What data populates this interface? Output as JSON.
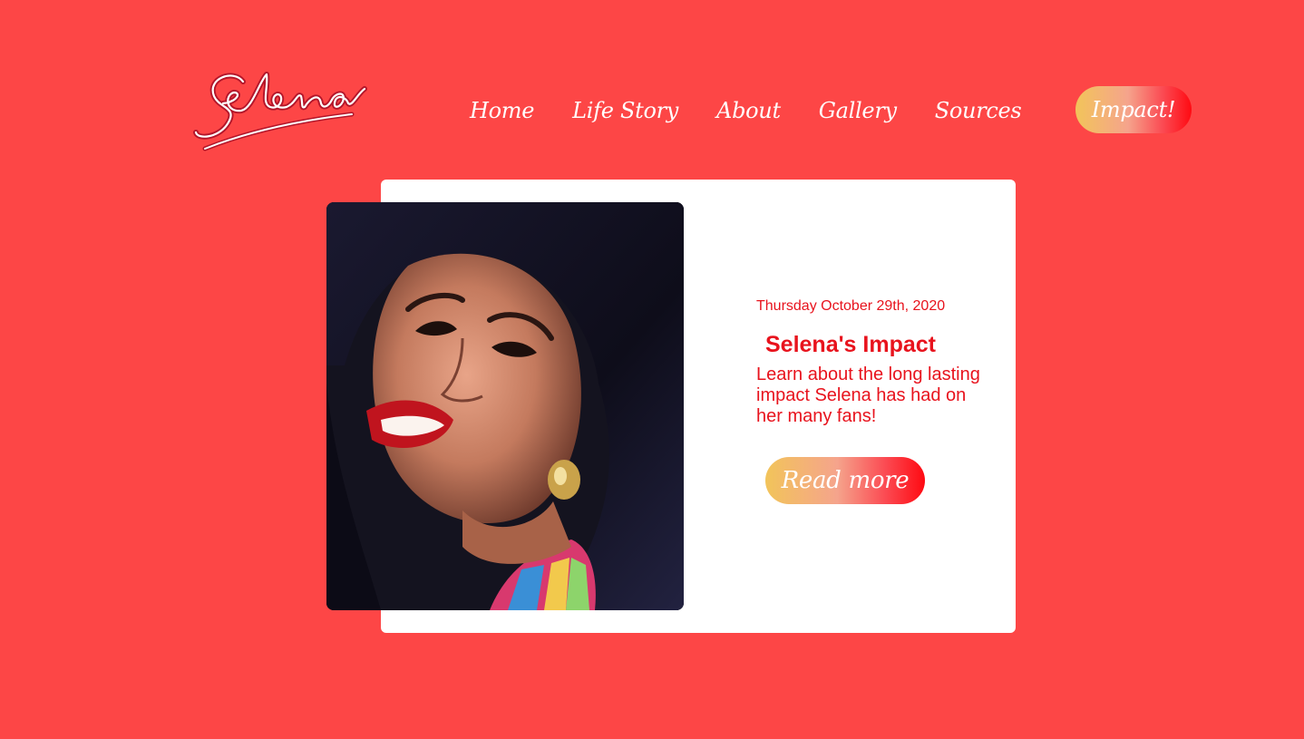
{
  "logo": {
    "text": "Selena"
  },
  "nav": {
    "items": [
      {
        "label": "Home"
      },
      {
        "label": "Life Story"
      },
      {
        "label": "About"
      },
      {
        "label": "Gallery"
      },
      {
        "label": "Sources"
      }
    ],
    "cta_label": "Impact!"
  },
  "article": {
    "date": "Thursday October 29th, 2020",
    "title": "Selena's Impact",
    "body": "Learn about the long lasting impact Selena has had on her many fans!",
    "button_label": "Read more"
  },
  "colors": {
    "background": "#fd4646",
    "card": "#ffffff",
    "text_accent": "#e8131d",
    "gradient_start": "#f2c45a",
    "gradient_end": "#ff0a12"
  }
}
